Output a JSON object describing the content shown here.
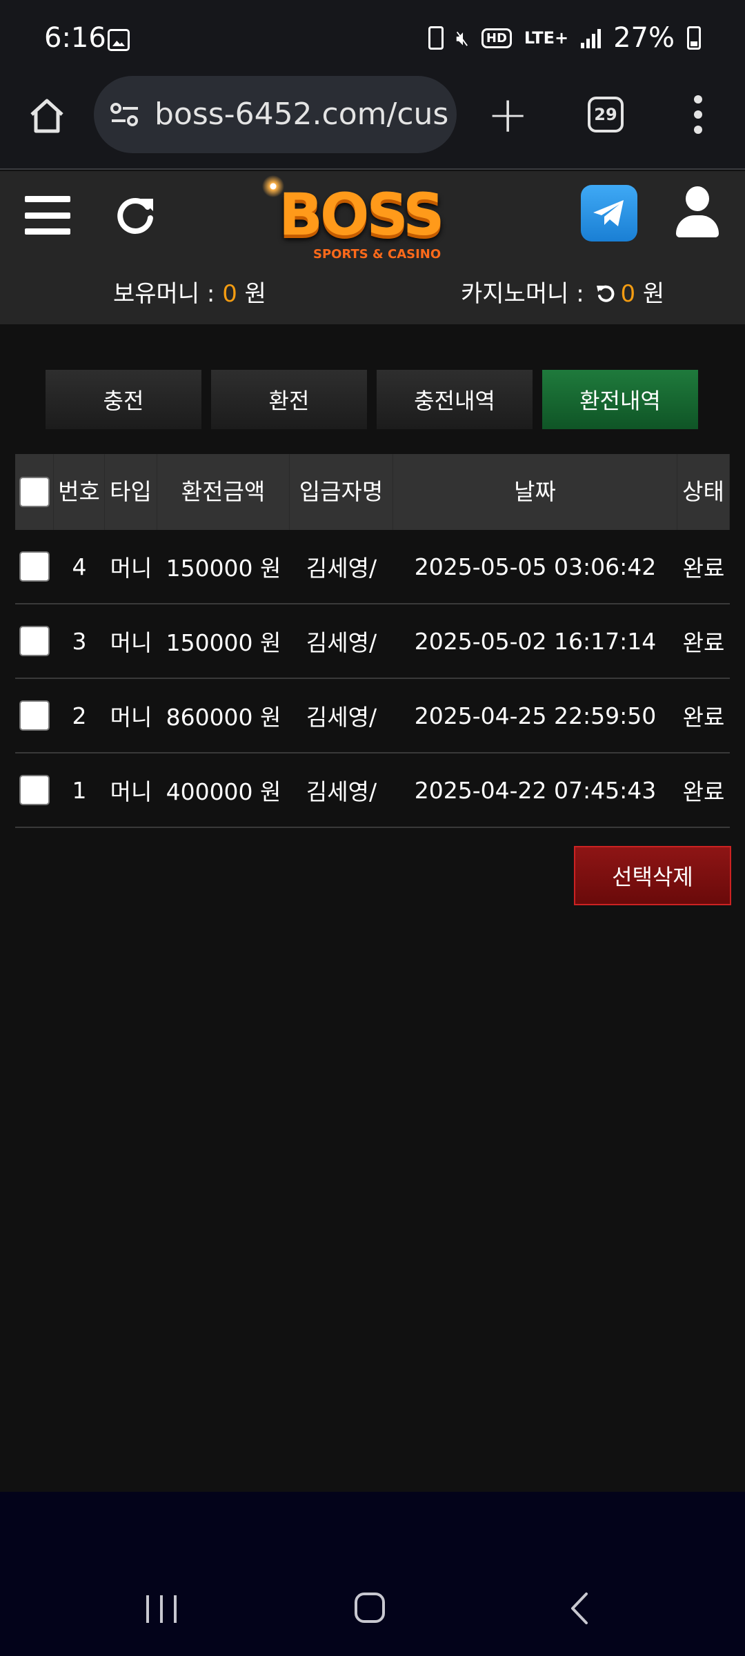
{
  "status_bar": {
    "time": "6:16",
    "network": "LTE+",
    "battery": "27%",
    "icons": [
      "image-icon",
      "battery-saver-icon",
      "mute-icon",
      "hd-icon",
      "signal-icon",
      "battery-icon"
    ]
  },
  "browser": {
    "url": "boss-6452.com/cus",
    "tab_count": "29"
  },
  "header": {
    "logo_text": "BOSS",
    "logo_sub": "SPORTS & CASINO",
    "holding_label": "보유머니 : ",
    "holding_value": "0",
    "casino_label": "카지노머니 : ",
    "casino_value": "0",
    "currency": " 원"
  },
  "tabs": [
    {
      "label": "충전",
      "active": false
    },
    {
      "label": "환전",
      "active": false
    },
    {
      "label": "충전내역",
      "active": false
    },
    {
      "label": "환전내역",
      "active": true
    }
  ],
  "table": {
    "headers": [
      "번호",
      "타입",
      "환전금액",
      "입금자명",
      "날짜",
      "상태"
    ],
    "rows": [
      {
        "no": "4",
        "type": "머니",
        "amount": "150000 원",
        "name": "김세영/",
        "date": "2025-05-05 03:06:42",
        "status": "완료"
      },
      {
        "no": "3",
        "type": "머니",
        "amount": "150000 원",
        "name": "김세영/",
        "date": "2025-05-02 16:17:14",
        "status": "완료"
      },
      {
        "no": "2",
        "type": "머니",
        "amount": "860000 원",
        "name": "김세영/",
        "date": "2025-04-25 22:59:50",
        "status": "완료"
      },
      {
        "no": "1",
        "type": "머니",
        "amount": "400000 원",
        "name": "김세영/",
        "date": "2025-04-22 07:45:43",
        "status": "완료"
      }
    ]
  },
  "delete_button": "선택삭제",
  "colors": {
    "accent_orange": "#f39c12",
    "active_tab": "#1f7a3c",
    "delete_red": "#8e1515"
  }
}
